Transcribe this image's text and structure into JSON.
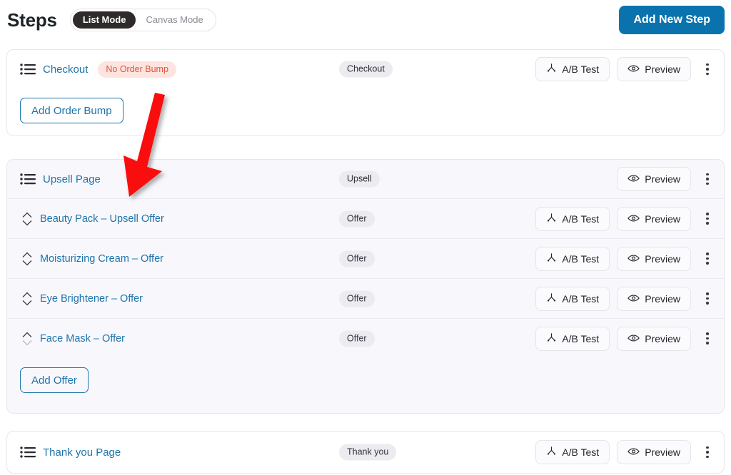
{
  "header": {
    "title": "Steps",
    "modes": [
      {
        "label": "List Mode",
        "active": true
      },
      {
        "label": "Canvas Mode",
        "active": false
      }
    ],
    "add_new_step_label": "Add New Step"
  },
  "labels": {
    "ab_test": "A/B Test",
    "preview": "Preview",
    "list_icon": "list-icon",
    "sort_icon": "sort-up-down-icon",
    "kebab_icon": "more-options-icon",
    "ab_test_icon": "split-test-icon",
    "preview_icon": "eye-icon"
  },
  "colors": {
    "accent_blue": "#0a73ad",
    "link_blue": "#1d74ab",
    "warn_bg": "#fde4de",
    "warn_text": "#e0553d",
    "pill_bg": "#ebebf0",
    "upsell_card_bg": "#f8f7fc",
    "annotation_red": "#fa0a0a"
  },
  "cards": [
    {
      "id": "checkout-card",
      "rows": [
        {
          "name": "Checkout",
          "badge": "No Order Bump",
          "type": "Checkout",
          "has_ab_test": true,
          "has_preview": true,
          "has_kebab": true
        }
      ],
      "footer_button": "Add Order Bump"
    },
    {
      "id": "upsell-card",
      "rows": [
        {
          "name": "Upsell Page",
          "type": "Upsell",
          "has_ab_test": false,
          "has_preview": true,
          "has_kebab": true
        },
        {
          "name": "Beauty Pack – Upsell Offer",
          "type": "Offer",
          "has_ab_test": true,
          "has_preview": true,
          "has_kebab": true
        },
        {
          "name": "Moisturizing Cream – Offer",
          "type": "Offer",
          "has_ab_test": true,
          "has_preview": true,
          "has_kebab": true
        },
        {
          "name": "Eye Brightener – Offer",
          "type": "Offer",
          "has_ab_test": true,
          "has_preview": true,
          "has_kebab": true
        },
        {
          "name": "Face Mask – Offer",
          "type": "Offer",
          "has_ab_test": true,
          "has_preview": true,
          "has_kebab": true
        }
      ],
      "footer_button": "Add Offer"
    },
    {
      "id": "thankyou-card",
      "rows": [
        {
          "name": "Thank you Page",
          "type": "Thank you",
          "has_ab_test": true,
          "has_preview": true,
          "has_kebab": true
        }
      ]
    }
  ]
}
